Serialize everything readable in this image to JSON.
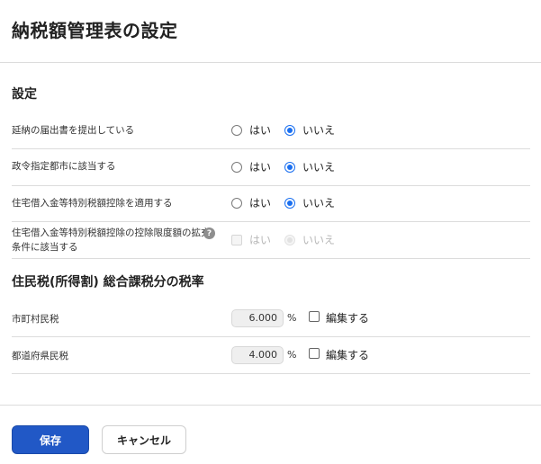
{
  "page": {
    "title": "納税額管理表の設定"
  },
  "settings": {
    "title": "設定",
    "rows": [
      {
        "label": "延納の届出書を提出している",
        "yes": "はい",
        "no": "いいえ",
        "selected": "no",
        "disabled": false
      },
      {
        "label": "政令指定都市に該当する",
        "yes": "はい",
        "no": "いいえ",
        "selected": "no",
        "disabled": false
      },
      {
        "label": "住宅借入金等特別税額控除を適用する",
        "yes": "はい",
        "no": "いいえ",
        "selected": "no",
        "disabled": false
      },
      {
        "label": "住宅借入金等特別税額控除の控除限度額の拡充条件に該当する",
        "yes": "はい",
        "no": "いいえ",
        "selected": "no",
        "disabled": true,
        "help_icon": "question-circle-icon"
      }
    ]
  },
  "rates": {
    "title": "住民税(所得割) 総合課税分の税率",
    "rows": [
      {
        "label": "市町村民税",
        "value": "6.000",
        "unit": "%",
        "edit_label": "編集する",
        "edit_checked": false
      },
      {
        "label": "都道府県民税",
        "value": "4.000",
        "unit": "%",
        "edit_label": "編集する",
        "edit_checked": false
      }
    ]
  },
  "footer": {
    "save_label": "保存",
    "cancel_label": "キャンセル"
  },
  "colors": {
    "primary": "#2158c6",
    "radio_accent": "#1a6ff0",
    "divider": "#dcdcdc"
  }
}
